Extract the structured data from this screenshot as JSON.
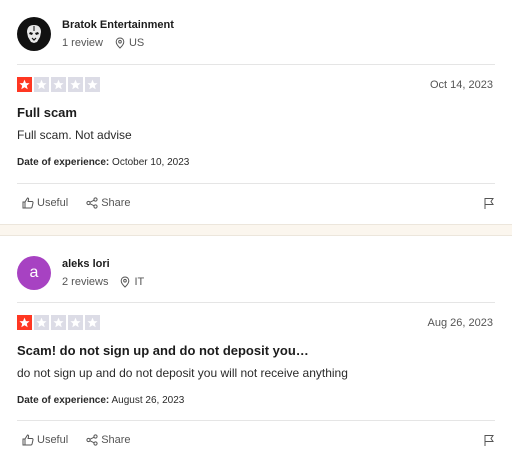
{
  "reviews": [
    {
      "user_name": "Bratok Entertainment",
      "avatar_icon": "predator-mask-icon",
      "review_count": "1 review",
      "country": "US",
      "rating": 1,
      "max_rating": 5,
      "date": "Oct 14, 2023",
      "title": "Full scam",
      "body": "Full scam. Not advise",
      "experience_label": "Date of experience:",
      "experience_date": "October 10, 2023",
      "useful_label": "Useful",
      "share_label": "Share"
    },
    {
      "user_name": "aleks lori",
      "avatar_letter": "a",
      "avatar_color": "#a742c2",
      "review_count": "2 reviews",
      "country": "IT",
      "rating": 1,
      "max_rating": 5,
      "date": "Aug 26, 2023",
      "title": "Scam! do not sign up and do not deposit you…",
      "body": "do not sign up and do not deposit you will not receive anything",
      "experience_label": "Date of experience:",
      "experience_date": "August 26, 2023",
      "useful_label": "Useful",
      "share_label": "Share"
    }
  ],
  "colors": {
    "star_active": "#ff3722",
    "star_inactive": "#dcdce6",
    "separator": "#fbf6ee"
  }
}
